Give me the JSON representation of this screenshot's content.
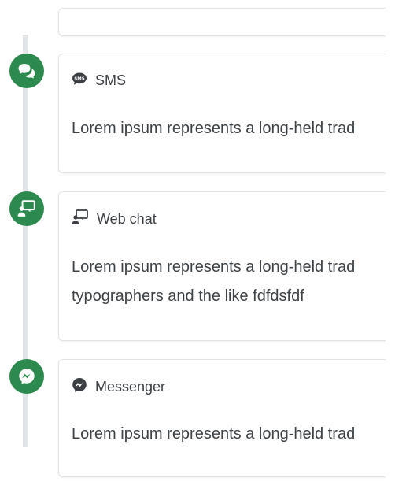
{
  "timeline": {
    "items": [
      {
        "channel_label": "SMS",
        "channel_icon": "sms-icon",
        "node_icon": "chat-bubbles-icon",
        "lines": [
          "Lorem ipsum represents a long-held trad"
        ]
      },
      {
        "channel_label": "Web chat",
        "channel_icon": "web-chat-icon",
        "node_icon": "web-chat-icon",
        "lines": [
          "Lorem ipsum represents a long-held trad",
          "typographers and the like fdfdsfdf"
        ]
      },
      {
        "channel_label": "Messenger",
        "channel_icon": "messenger-icon",
        "node_icon": "messenger-icon",
        "lines": [
          "Lorem ipsum represents a long-held trad"
        ]
      }
    ]
  },
  "colors": {
    "accent_green": "#2d8a4e",
    "timeline_line": "#e3e6e8",
    "card_border": "#e1e4e6",
    "text": "#3d4246"
  }
}
